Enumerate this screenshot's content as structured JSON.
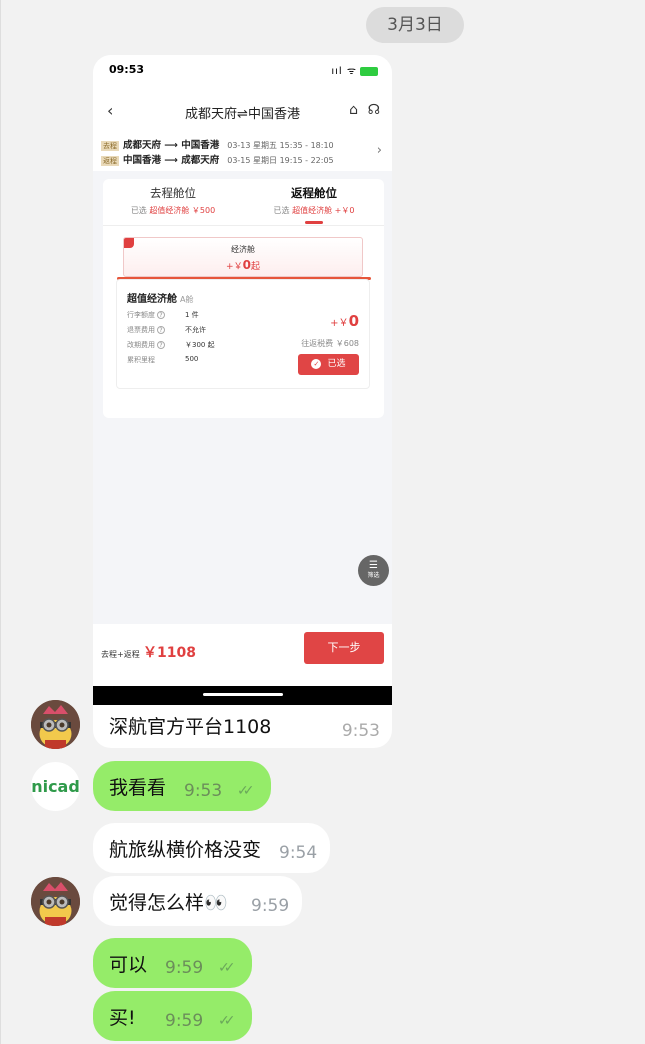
{
  "date_label": "3月3日",
  "shared_screenshot": {
    "status_time": "09:53",
    "status_icons": "ııl ᯤ",
    "nav_back": "‹",
    "nav_title": "成都天府⇌中国香港",
    "nav_home_icon": "⌂",
    "nav_service_icon": "☊",
    "routes": [
      {
        "tag": "去程",
        "name": "成都天府 ⟶ 中国香港",
        "meta": "03-13  星期五  15:35 - 18:10"
      },
      {
        "tag": "返程",
        "name": "中国香港 ⟶ 成都天府",
        "meta": "03-15  星期日  19:15 - 22:05"
      }
    ],
    "routes_arrow": "›",
    "tabs": [
      {
        "title": "去程舱位",
        "selected_prefix": "已选",
        "selected_value": "超值经济舱 ￥500"
      },
      {
        "title": "返程舱位",
        "selected_prefix": "已选",
        "selected_value": "超值经济舱 +￥0"
      }
    ],
    "cabin_name": "经济舱",
    "cabin_price_prefix": "+￥",
    "cabin_price_value": "0",
    "cabin_price_suffix": "起",
    "fare": {
      "title": "超值经济舱",
      "class_code": "A舱",
      "rows": [
        {
          "label": "行李额度",
          "value": "1 件"
        },
        {
          "label": "退票费用",
          "value": "不允许"
        },
        {
          "label": "改期费用",
          "value": "￥300 起"
        },
        {
          "label": "累积里程",
          "value": "500"
        }
      ],
      "price_prefix": "+￥",
      "price_value": "0",
      "tax": "往返税费 ￥608",
      "selected_label": "已选"
    },
    "fab_label": "筛选",
    "total_label": "去程+返程",
    "total_price": "￥1108",
    "next_button": "下一步"
  },
  "caption_text": "深航官方平台1108",
  "caption_time": "9:53",
  "messages": [
    {
      "text": "我看看",
      "time": "9:53",
      "ticks": "✓✓"
    },
    {
      "text": "航旅纵横价格没变",
      "time": "9:54"
    },
    {
      "text": "觉得怎么样👀",
      "time": "9:59"
    },
    {
      "text": "可以",
      "time": "9:59",
      "ticks": "✓✓"
    },
    {
      "text": "买!",
      "time": "9:59",
      "ticks": "✓✓"
    }
  ],
  "nicad_logo": "nicad"
}
